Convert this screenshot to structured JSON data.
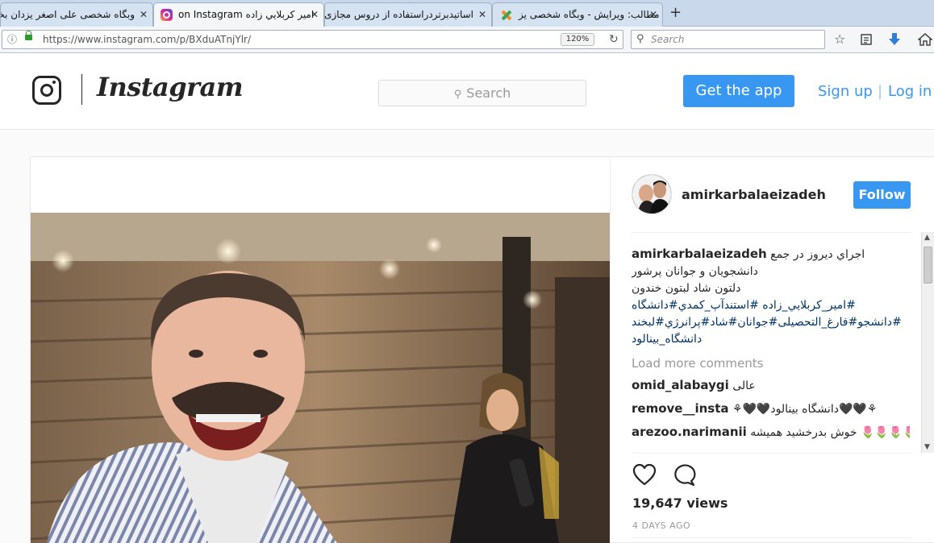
{
  "browser": {
    "tabs": [
      {
        "title": "وبگاه شخصی علی اصغر یزدان بخش",
        "state": "inactive"
      },
      {
        "title": "امير کربلايي زاده on Instagram",
        "state": "active"
      },
      {
        "title": "اساتیدبرتردراستفاده از دروس مجازی",
        "state": "inactive"
      },
      {
        "title": "مطالب: ویرایش - وبگاه شخصی یز",
        "state": "inactive"
      }
    ],
    "close_glyph": "✕",
    "new_tab_glyph": "+",
    "url": "https://www.instagram.com/p/BXduATnjYlr/",
    "zoom": "120%",
    "search_placeholder": "Search"
  },
  "instagram": {
    "wordmark": "Instagram",
    "search_placeholder": "Search",
    "get_app": "Get the app",
    "sign_up": "Sign up",
    "separator": "|",
    "log_in": "Log in"
  },
  "post": {
    "username": "amirkarbalaeizadeh",
    "follow": "Follow",
    "caption": {
      "username": "amirkarbalaeizadeh",
      "line1": "اجراي ديروز در جمع",
      "line2": "دانشجويان و جوانان پرشور",
      "line3": "دلتون شاد لبتون خندون",
      "tags1": "#امير_كربلايي_زاده #استندآپ_كمدي#دانشگاه",
      "tags2": "#دانشجو#فارغ_التحصيلى#جوانان#شاد#پرانرژي#لبخند",
      "tags3": "دانشگاه_بينالود"
    },
    "load_more": "Load more comments",
    "comments": [
      {
        "username": "omid_alabaygi",
        "text": "عالى"
      },
      {
        "username": "remove__insta",
        "text": "⚘🖤🖤دانشگاه بينالود🖤🖤⚘"
      },
      {
        "username": "arezoo.narimanii",
        "text": "🌷🌷🌷🌷 خوش بدرخشید همیشه"
      }
    ],
    "views": "19,647 views",
    "time_ago": "4 DAYS AGO"
  },
  "icons": {
    "browser": [
      "instagram-favicon",
      "lock-icon",
      "info-icon",
      "reload-icon",
      "search-icon",
      "bookmark-star-icon",
      "reading-list-icon",
      "download-arrow-icon",
      "home-icon",
      "site-favicon"
    ],
    "instagram": [
      "instagram-glyph-icon",
      "search-icon",
      "heart-icon",
      "comment-bubble-icon"
    ]
  }
}
